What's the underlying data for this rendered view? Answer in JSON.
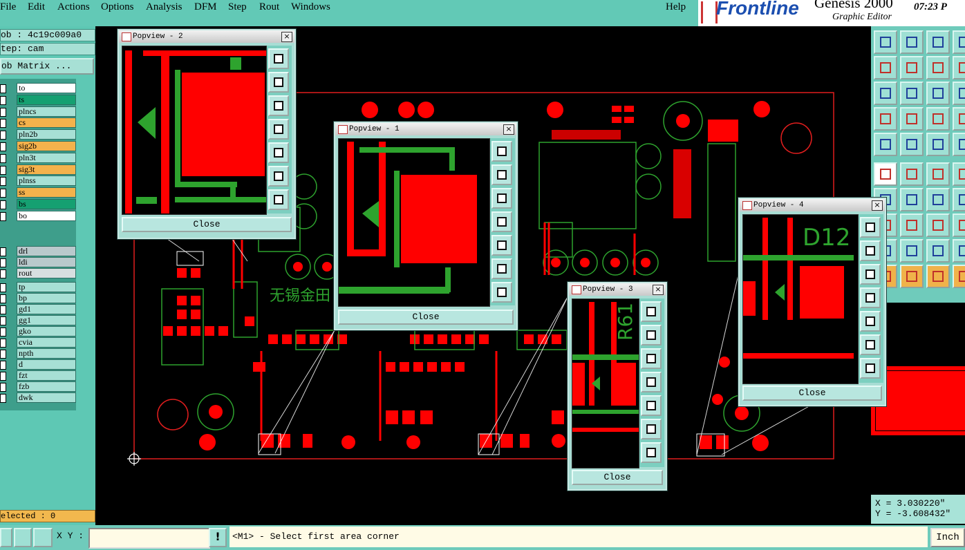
{
  "menu": {
    "items": [
      "File",
      "Edit",
      "Actions",
      "Options",
      "Analysis",
      "DFM",
      "Step",
      "Rout",
      "Windows"
    ],
    "help": "Help"
  },
  "branding": {
    "logo": "Frontline",
    "product": "Genesis 2000",
    "subtitle": "Graphic Editor",
    "time": "07:23 P"
  },
  "job": {
    "job_label": "ob : 4c19c009a0",
    "step_label": "tep: cam",
    "matrix_button": "ob Matrix ..."
  },
  "layers": [
    {
      "name": "to",
      "color": "#ffffff"
    },
    {
      "name": "ts",
      "color": "#15a071"
    },
    {
      "name": "plncs",
      "color": "#a7e0d5"
    },
    {
      "name": "cs",
      "color": "#f4b24c"
    },
    {
      "name": "pln2b",
      "color": "#a7e0d5"
    },
    {
      "name": "sig2b",
      "color": "#f4b24c"
    },
    {
      "name": "pln3t",
      "color": "#a7e0d5"
    },
    {
      "name": "sig3t",
      "color": "#f4b24c"
    },
    {
      "name": "plnss",
      "color": "#a7e0d5"
    },
    {
      "name": "ss",
      "color": "#f4b24c"
    },
    {
      "name": "bs",
      "color": "#15a071"
    },
    {
      "name": "bo",
      "color": "#ffffff"
    },
    {
      "name": "drl",
      "color": "#b9c9cc"
    },
    {
      "name": "ldi",
      "color": "#b9c9cc"
    },
    {
      "name": "rout",
      "color": "#d7dfe0"
    },
    {
      "name": "tp",
      "color": "#a7e0d5"
    },
    {
      "name": "bp",
      "color": "#a7e0d5"
    },
    {
      "name": "gd1",
      "color": "#a7e0d5"
    },
    {
      "name": "gg1",
      "color": "#a7e0d5"
    },
    {
      "name": "gko",
      "color": "#a7e0d5"
    },
    {
      "name": "cvia",
      "color": "#a7e0d5"
    },
    {
      "name": "npth",
      "color": "#a7e0d5"
    },
    {
      "name": "d",
      "color": "#a7e0d5"
    },
    {
      "name": "fzt",
      "color": "#a7e0d5"
    },
    {
      "name": "fzb",
      "color": "#a7e0d5"
    },
    {
      "name": "dwk",
      "color": "#a7e0d5"
    }
  ],
  "selected": "elected : 0",
  "popups": [
    {
      "title": "Popview - 2",
      "close": "Close"
    },
    {
      "title": "Popview - 1",
      "close": "Close"
    },
    {
      "title": "Popview - 3",
      "close": "Close"
    },
    {
      "title": "Popview - 4",
      "close": "Close"
    }
  ],
  "board_labels": {
    "chinese": "无锡金田",
    "d12": "D12",
    "r61": "R61"
  },
  "coords": {
    "x": "X = 3.030220\"",
    "y": "Y = -3.608432\""
  },
  "status": {
    "xy_label": "X Y :",
    "xy_value": "",
    "prompt": "<M1> - Select first area corner",
    "units": "Inch"
  },
  "colors": {
    "pad": "#ff0000",
    "trace": "#1e9b1e",
    "silk": "#2ea32e",
    "outline": "#e11e1e",
    "panel": "#5ec8b4"
  }
}
